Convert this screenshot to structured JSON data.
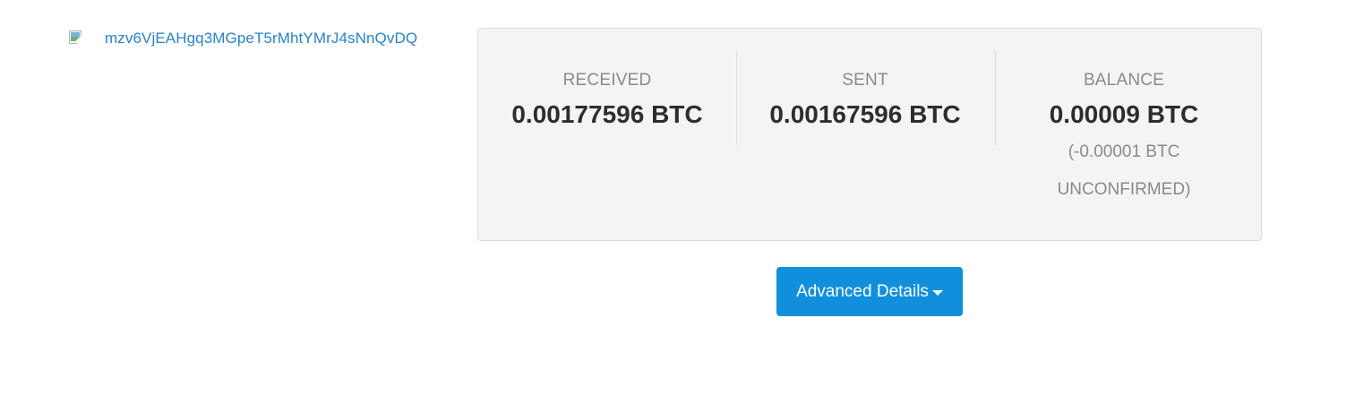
{
  "address": {
    "qr_image_icon": "broken-image-icon",
    "text": "mzv6VjEAHgq3MGpeT5rMhtYMrJ4sNnQvDQ",
    "link_color": "#2a82c6"
  },
  "summary": {
    "received": {
      "label": "RECEIVED",
      "value": "0.00177596 BTC"
    },
    "sent": {
      "label": "SENT",
      "value": "0.00167596 BTC"
    },
    "balance": {
      "label": "BALANCE",
      "value": "0.00009 BTC",
      "unconfirmed_line1": "(-0.00001 BTC",
      "unconfirmed_line2": "UNCONFIRMED)"
    },
    "background_color": "#f4f4f4"
  },
  "actions": {
    "advanced_details_label": "Advanced Details",
    "caret_icon": "caret-down-icon",
    "button_color": "#118fdc"
  }
}
